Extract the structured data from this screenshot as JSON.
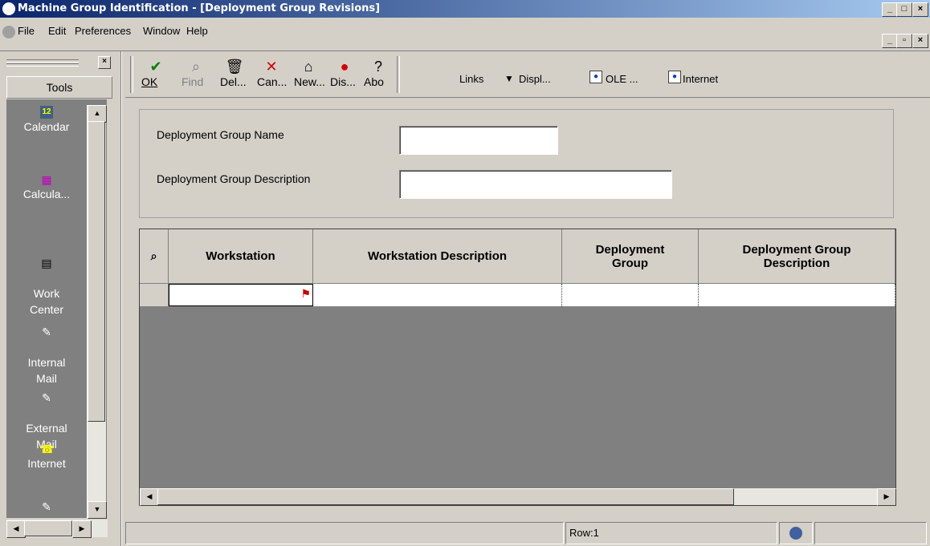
{
  "window": {
    "title": "Machine Group Identification - [Deployment Group Revisions]",
    "controls": [
      "_",
      "□",
      "×"
    ],
    "child_controls": [
      "_",
      "▫",
      "×"
    ]
  },
  "menu": [
    "File",
    "Edit",
    "Preferences",
    "Window",
    "Help"
  ],
  "tools_panel": {
    "header": "Tools",
    "items": [
      {
        "label": "Calendar",
        "icon": "calendar-icon"
      },
      {
        "label": "Calcula...",
        "icon": "calculator-icon"
      },
      {
        "label": "Work\nCenter",
        "icon": "work-center-icon"
      },
      {
        "label": "Internal\nMail",
        "icon": "internal-mail-icon"
      },
      {
        "label": "External\nMail",
        "icon": "external-mail-icon"
      },
      {
        "label": "Internet",
        "icon": "internet-icon"
      }
    ]
  },
  "toolbar": {
    "buttons": [
      {
        "label": "OK",
        "icon": "check-icon",
        "color": "#008000"
      },
      {
        "label": "Find",
        "icon": "find-icon",
        "color": "#808080"
      },
      {
        "label": "Del...",
        "icon": "trash-icon",
        "color": "#000000"
      },
      {
        "label": "Can...",
        "icon": "cancel-icon",
        "color": "#c00000"
      },
      {
        "label": "New...",
        "icon": "new-icon",
        "color": "#000000"
      },
      {
        "label": "Dis...",
        "icon": "display-icon",
        "color": "#c00000"
      },
      {
        "label": "Abo",
        "icon": "about-icon",
        "color": "#000000"
      }
    ],
    "links": "Links",
    "display": "Displ...",
    "ole": "OLE ...",
    "internet": "Internet"
  },
  "form": {
    "name_label": "Deployment Group Name",
    "name_value": "",
    "desc_label": "Deployment Group Description",
    "desc_value": ""
  },
  "grid": {
    "columns": [
      "Workstation",
      "Workstation Description",
      "Deployment Group",
      "Deployment Group Description"
    ],
    "rows": [
      [
        "",
        "",
        "",
        ""
      ]
    ]
  },
  "status": {
    "row": "Row:1"
  }
}
